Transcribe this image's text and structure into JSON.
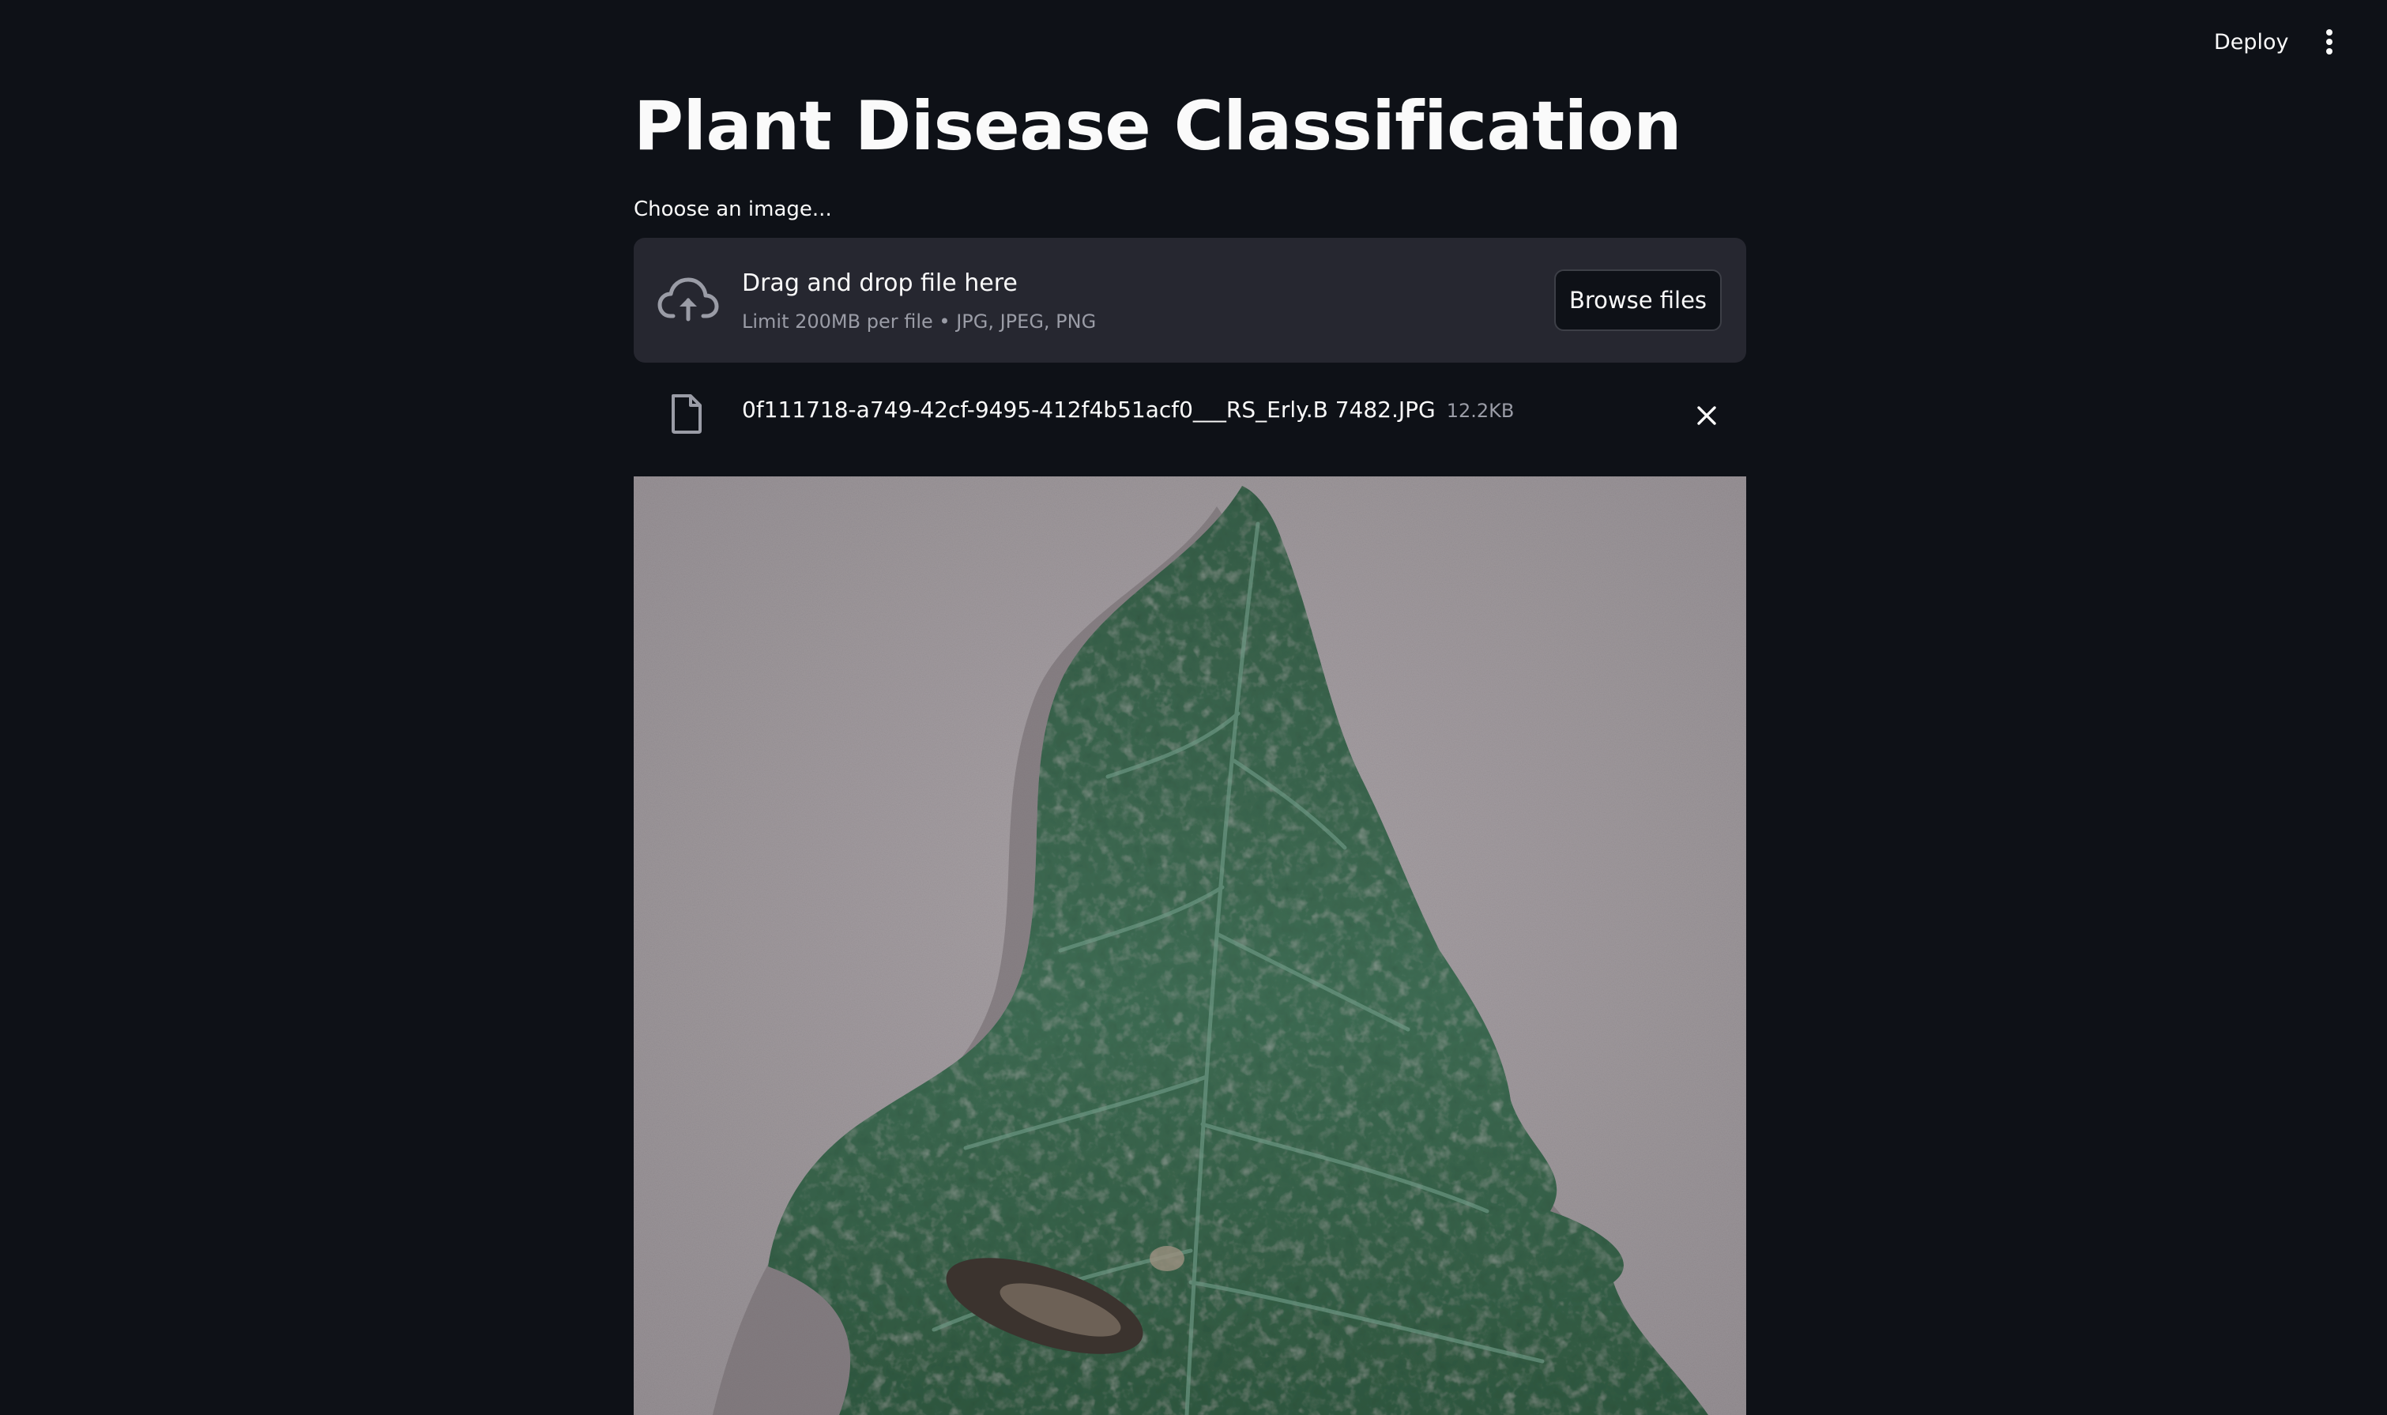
{
  "header": {
    "deploy_label": "Deploy",
    "menu_icon": "vertical-ellipsis-icon"
  },
  "main": {
    "title": "Plant Disease Classification",
    "uploader": {
      "label": "Choose an image...",
      "dropzone_title": "Drag and drop file here",
      "dropzone_limit": "Limit 200MB per file • JPG, JPEG, PNG",
      "browse_label": "Browse files",
      "upload_icon": "cloud-upload-icon"
    },
    "uploaded_file": {
      "name": "0f111718-a749-42cf-9495-412f4b51acf0___RS_Erly.B 7482.JPG",
      "size": "12.2KB",
      "file_icon": "file-icon",
      "remove_icon": "close-icon"
    },
    "preview": {
      "subject": "tomato-leaf-image"
    }
  },
  "colors": {
    "background": "#0e1117",
    "surface": "#262730",
    "text": "#fafafa",
    "muted_text": "#9a9ca6"
  }
}
